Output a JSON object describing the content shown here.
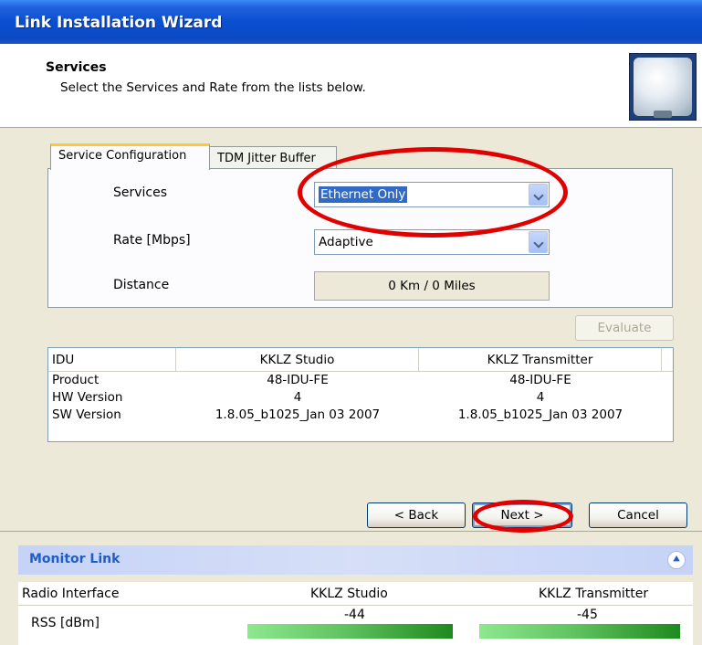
{
  "window": {
    "title": "Link Installation Wizard"
  },
  "header": {
    "title": "Services",
    "subtitle": "Select the Services and Rate from the lists below.",
    "icon": "antenna-dish-icon"
  },
  "tabs": [
    {
      "label": "Service Configuration",
      "active": true
    },
    {
      "label": "TDM Jitter Buffer",
      "active": false
    }
  ],
  "service_config": {
    "services_label": "Services",
    "services_value": "Ethernet Only",
    "rate_label": "Rate [Mbps]",
    "rate_value": "Adaptive",
    "distance_label": "Distance",
    "distance_value": "0 Km / 0 Miles"
  },
  "evaluate_button": "Evaluate",
  "idu_table": {
    "headers": [
      "IDU",
      "KKLZ Studio",
      "KKLZ Transmitter"
    ],
    "rows": [
      [
        "Product",
        "48-IDU-FE",
        "48-IDU-FE"
      ],
      [
        "HW Version",
        "4",
        "4"
      ],
      [
        "SW Version",
        "1.8.05_b1025_Jan 03 2007",
        "1.8.05_b1025_Jan 03 2007"
      ]
    ]
  },
  "nav_buttons": {
    "back": "< Back",
    "next": "Next >",
    "cancel": "Cancel"
  },
  "monitor": {
    "title": "Monitor Link",
    "collapse_icon": "double-chevron-up-icon",
    "headers": [
      "Radio Interface",
      "KKLZ Studio",
      "KKLZ Transmitter"
    ],
    "rss_label": "RSS [dBm]",
    "rss_studio": "-44",
    "rss_transmitter": "-45"
  },
  "colors": {
    "highlight": "#e00000",
    "title_bar": "#0a4fd0",
    "selection": "#316ac5"
  }
}
